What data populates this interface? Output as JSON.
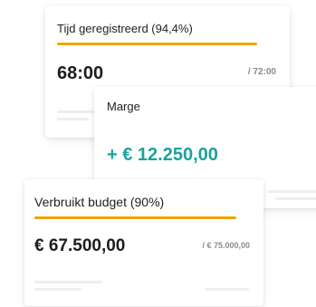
{
  "colors": {
    "accent": "#f0a500",
    "positive": "#1aa39a"
  },
  "cards": {
    "time": {
      "title": "Tijd geregistreerd (94,4%)",
      "value": "68:00",
      "total": "/ 72:00"
    },
    "margin": {
      "title": "Marge",
      "value": "+ € 12.250,00"
    },
    "budget": {
      "title": "Verbruikt budget (90%)",
      "value": "€ 67.500,00",
      "total": "/ € 75.000,00"
    }
  }
}
